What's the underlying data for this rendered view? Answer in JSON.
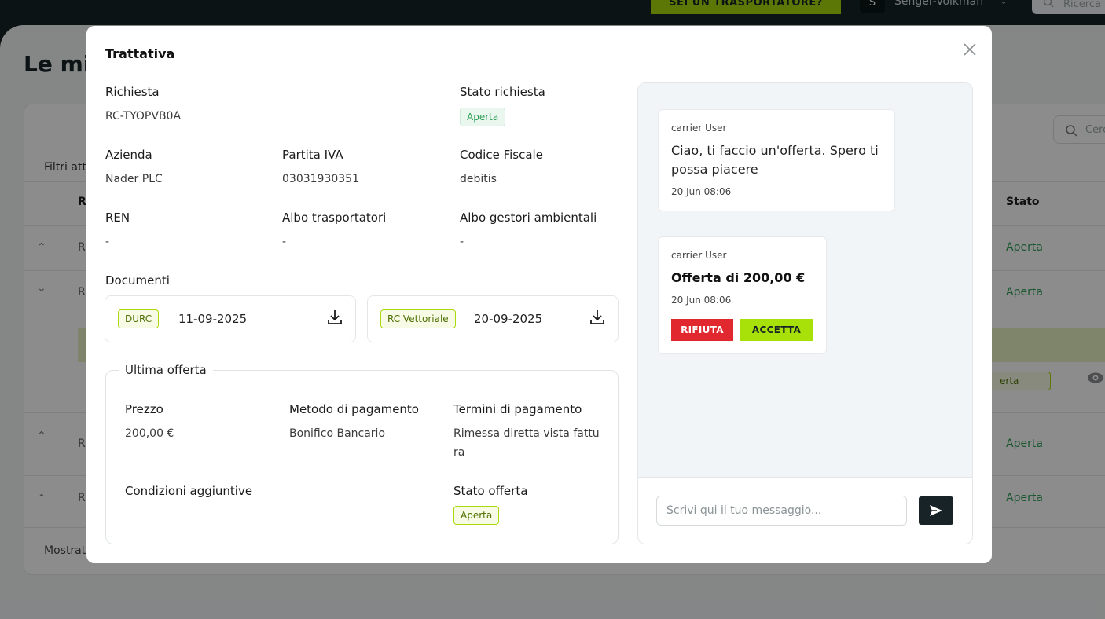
{
  "background": {
    "topbar": {
      "cta_label": "SEI UN TRASPORTATORE?",
      "avatar_initial": "S",
      "user_name": "Senger-Volkman",
      "search_placeholder": "Ricerca"
    },
    "page_title": "Le mi",
    "list_search_placeholder": "Cerc",
    "filters_label": "Filtri att",
    "columns": {
      "r": "R",
      "stato": "Stato"
    },
    "rows": [
      {
        "r": "R",
        "stato": "Aperta"
      },
      {
        "r": "R",
        "stato": "Aperta"
      },
      {
        "r": "R",
        "stato": "Aperta"
      },
      {
        "r": "R",
        "stato": "Aperta"
      }
    ],
    "inner_badge": "erta",
    "footer_label": "Mostrat"
  },
  "modal": {
    "title": "Trattativa",
    "fields": {
      "richiesta_label": "Richiesta",
      "richiesta_value": "RC-TYOPVB0A",
      "stato_richiesta_label": "Stato richiesta",
      "stato_richiesta_value": "Aperta",
      "azienda_label": "Azienda",
      "azienda_value": "Nader PLC",
      "partita_iva_label": "Partita IVA",
      "partita_iva_value": "03031930351",
      "codice_fiscale_label": "Codice Fiscale",
      "codice_fiscale_value": "debitis",
      "ren_label": "REN",
      "ren_value": "-",
      "albo_trasportatori_label": "Albo trasportatori",
      "albo_trasportatori_value": "-",
      "albo_gestori_label": "Albo gestori ambientali",
      "albo_gestori_value": "-"
    },
    "documents_label": "Documenti",
    "documents": [
      {
        "type": "DURC",
        "date": "11-09-2025"
      },
      {
        "type": "RC Vettoriale",
        "date": "20-09-2025"
      }
    ],
    "last_offer": {
      "legend": "Ultima offerta",
      "prezzo_label": "Prezzo",
      "prezzo_value": "200,00 €",
      "metodo_label": "Metodo di pagamento",
      "metodo_value": "Bonifico Bancario",
      "termini_label": "Termini di pagamento",
      "termini_value_line1": "Rimessa diretta vista fattu",
      "termini_value_line2": "ra",
      "condizioni_label": "Condizioni aggiuntive",
      "stato_offerta_label": "Stato offerta",
      "stato_offerta_value": "Aperta"
    },
    "chat": {
      "messages": [
        {
          "sender": "carrier User",
          "text": "Ciao, ti faccio un'offerta. Spero ti possa piacere",
          "time": "20 Jun 08:06"
        },
        {
          "sender": "carrier User",
          "offer": "Offerta di 200,00 €",
          "time": "20 Jun 08:06",
          "reject_label": "RIFIUTA",
          "accept_label": "ACCETTA"
        }
      ],
      "input_placeholder": "Scrivi qui il tuo messaggio..."
    }
  },
  "colors": {
    "accent_lime": "#a8d90a",
    "reject_red": "#e0282e",
    "status_green": "#2e9e56",
    "dark": "#172326"
  }
}
